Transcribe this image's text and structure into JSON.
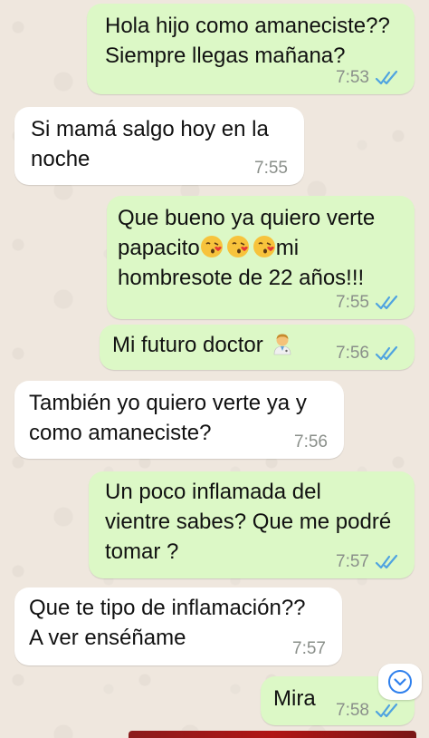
{
  "messages": [
    {
      "dir": "out",
      "text": "Hola hijo como amaneciste??\nSiempre llegas mañana?",
      "time": "7:53",
      "read": true
    },
    {
      "dir": "in",
      "text": "Si mamá salgo hoy en la\nnoche",
      "time": "7:55"
    },
    {
      "dir": "out",
      "text_line1": "Que bueno ya quiero verte",
      "text_line2_start": "papacito",
      "text_line2_end": "mi",
      "text_line3": "hombresote de 22 años!!!",
      "emojis": [
        "kiss-emoji",
        "kiss-emoji",
        "kiss-emoji"
      ],
      "time": "7:55",
      "read": true
    },
    {
      "dir": "out",
      "text": "Mi futuro doctor",
      "emoji": "doctor-emoji",
      "time": "7:56",
      "read": true
    },
    {
      "dir": "in",
      "text": "También yo quiero verte ya y\ncomo amaneciste?",
      "time": "7:56"
    },
    {
      "dir": "out",
      "text": "Un poco inflamada del\nvientre sabes? Que me podré\ntomar ?",
      "time": "7:57",
      "read": true
    },
    {
      "dir": "in",
      "text": "Que te tipo de inflamación??\nA ver enséñame",
      "time": "7:57"
    },
    {
      "dir": "out",
      "text": "Mira",
      "time": "7:58",
      "read": true
    }
  ],
  "colors": {
    "outgoing_bubble": "#dcf8c6",
    "incoming_bubble": "#ffffff",
    "read_ticks": "#4fa3e0",
    "background": "#efe7de"
  },
  "icons": {
    "read_receipt": "double-check-icon",
    "scroll_down": "chevron-down-circle-icon"
  }
}
